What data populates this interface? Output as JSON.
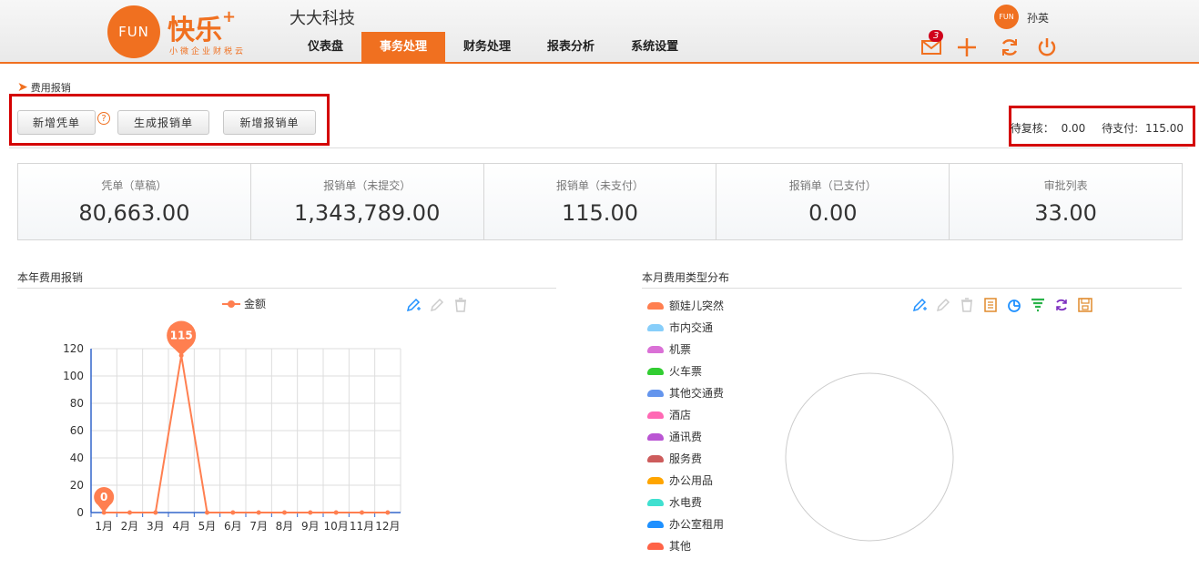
{
  "header": {
    "logo_circle_text": "FUN",
    "logo_text": "快乐",
    "logo_plus": "+",
    "logo_sub": "小微企业财税云",
    "company": "大大科技",
    "nav": [
      {
        "label": "仪表盘",
        "active": false
      },
      {
        "label": "事务处理",
        "active": true
      },
      {
        "label": "财务处理",
        "active": false
      },
      {
        "label": "报表分析",
        "active": false
      },
      {
        "label": "系统设置",
        "active": false
      }
    ],
    "user_avatar_text": "FUN",
    "user_name": "孙英",
    "mail_badge": "3",
    "icons": [
      "mail-icon",
      "plus-icon",
      "refresh-icon",
      "power-icon"
    ],
    "accent": "#f07020"
  },
  "breadcrumb": "费用报销",
  "toolbar": {
    "new_voucher": "新增凭单",
    "help": "?",
    "generate": "生成报销单",
    "new_expense": "新增报销单",
    "pending_review_label": "待复核：",
    "pending_review_value": "0.00",
    "pending_pay_label": "待支付:",
    "pending_pay_value": "115.00"
  },
  "cards": [
    {
      "label": "凭单（草稿）",
      "value": "80,663.00"
    },
    {
      "label": "报销单（未提交）",
      "value": "1,343,789.00"
    },
    {
      "label": "报销单（未支付）",
      "value": "115.00"
    },
    {
      "label": "报销单（已支付）",
      "value": "0.00"
    },
    {
      "label": "审批列表",
      "value": "33.00"
    }
  ],
  "left_panel": {
    "title": "本年费用报销"
  },
  "right_panel": {
    "title": "本月费用类型分布"
  },
  "chart_data": [
    {
      "type": "line",
      "legend": [
        "金额"
      ],
      "categories": [
        "1月",
        "2月",
        "3月",
        "4月",
        "5月",
        "6月",
        "7月",
        "8月",
        "9月",
        "10月",
        "11月",
        "12月"
      ],
      "series": [
        {
          "name": "金额",
          "values": [
            0,
            0,
            0,
            115,
            0,
            0,
            0,
            0,
            0,
            0,
            0,
            0
          ],
          "color": "#ff7f50"
        }
      ],
      "markers": [
        {
          "label": "0"
        },
        {
          "label": "115"
        }
      ],
      "ylim": [
        0,
        120
      ],
      "yticks": [
        0,
        20,
        40,
        60,
        80,
        100,
        120
      ],
      "grid": true
    },
    {
      "type": "pie",
      "legend_position": "left",
      "slices": [
        {
          "name": "额娃儿突然",
          "value": 0,
          "color": "#ff7f50"
        },
        {
          "name": "市内交通",
          "value": 0,
          "color": "#87cefa"
        },
        {
          "name": "机票",
          "value": 0,
          "color": "#da70d6"
        },
        {
          "name": "火车票",
          "value": 0,
          "color": "#32cd32"
        },
        {
          "name": "其他交通费",
          "value": 0,
          "color": "#6495ed"
        },
        {
          "name": "酒店",
          "value": 0,
          "color": "#ff69b4"
        },
        {
          "name": "通讯费",
          "value": 0,
          "color": "#ba55d3"
        },
        {
          "name": "服务费",
          "value": 0,
          "color": "#cd5c5c"
        },
        {
          "name": "办公用品",
          "value": 0,
          "color": "#ffa500"
        },
        {
          "name": "水电费",
          "value": 0,
          "color": "#40e0d0"
        },
        {
          "name": "办公室租用",
          "value": 0,
          "color": "#1e90ff"
        },
        {
          "name": "其他",
          "value": 0,
          "color": "#ff6347"
        }
      ]
    }
  ]
}
